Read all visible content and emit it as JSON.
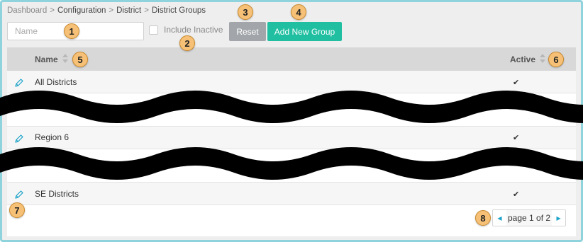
{
  "breadcrumb": {
    "items": [
      "Dashboard",
      "Configuration",
      "District",
      "District Groups"
    ],
    "separator": ">"
  },
  "filters": {
    "name_placeholder": "Name",
    "include_inactive_label": "Include Inactive",
    "include_inactive_checked": false,
    "reset_label": "Reset",
    "add_label": "Add New Group"
  },
  "table": {
    "columns": [
      "Name",
      "Active"
    ],
    "rows": [
      {
        "name": "All Districts",
        "active": "✔"
      },
      {
        "name": "Region 6",
        "active": "✔"
      },
      {
        "name": "SE Districts",
        "active": "✔"
      }
    ]
  },
  "pager": {
    "prefix": "page ",
    "current": "1",
    "middle": " of ",
    "total": "2"
  },
  "callouts": [
    "1",
    "2",
    "3",
    "4",
    "5",
    "6",
    "7",
    "8"
  ],
  "colors": {
    "accent": "#20bfa1",
    "reset": "#a2a6aa",
    "frame": "#8fd3dd",
    "callout": "#f6c177",
    "redaction": "#000000"
  },
  "icons": {
    "edit": "pencil-icon",
    "active": "checkmark-icon",
    "sort": "sort-icon",
    "prev": "caret-left-icon",
    "next": "caret-right-icon"
  }
}
